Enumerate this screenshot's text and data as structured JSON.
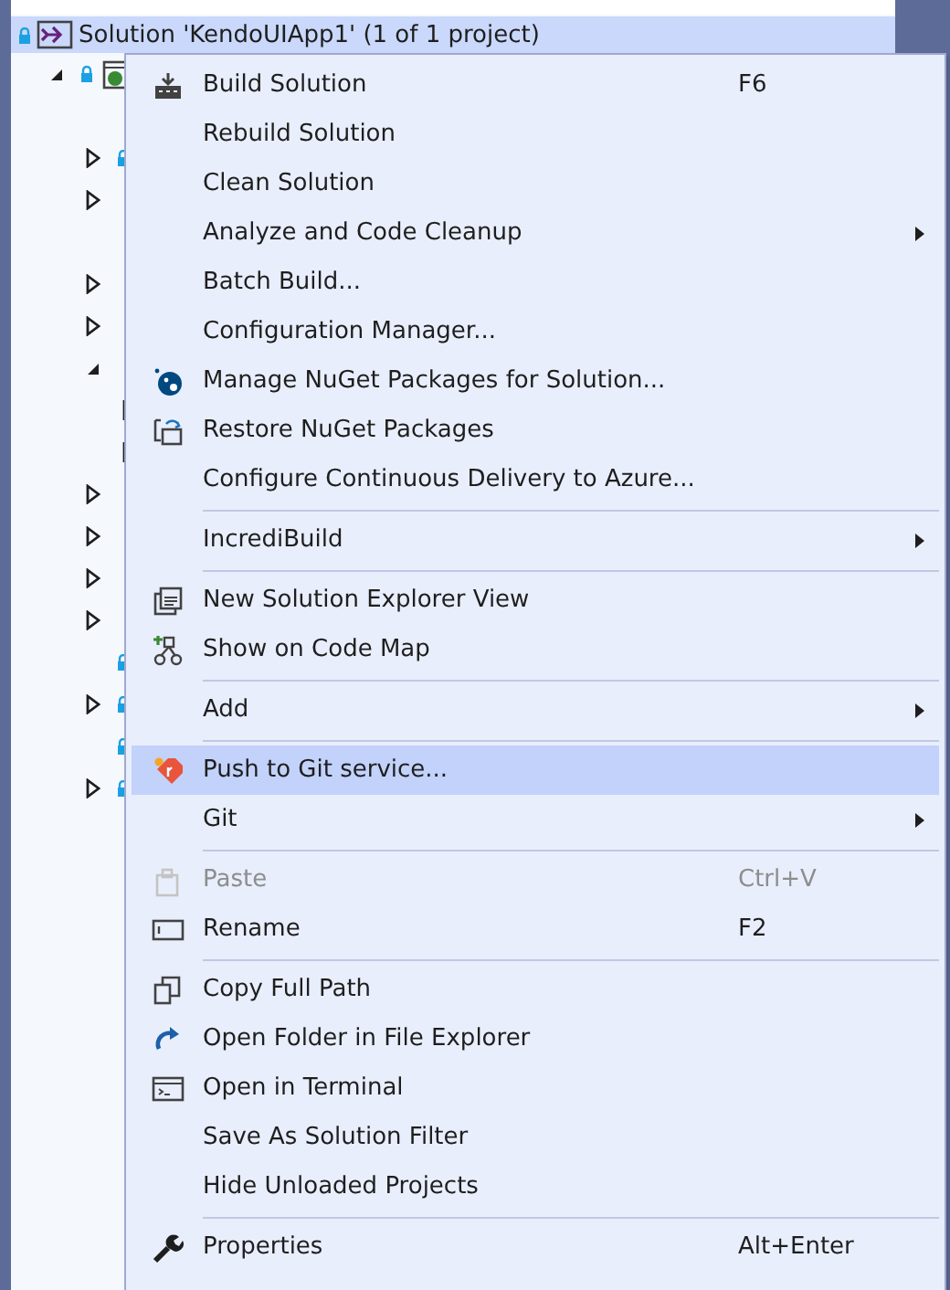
{
  "tree": {
    "root": {
      "label": "Solution 'KendoUIApp1' (1 of 1 project)",
      "selected": true
    },
    "rows": [
      {
        "expanded": true,
        "locked": true,
        "children": [
          {
            "locked": false
          },
          {
            "expanded": false,
            "locked": true
          },
          {
            "expanded": false,
            "locked": false
          },
          {
            "locked": false
          },
          {
            "expanded": false,
            "locked": false
          },
          {
            "expanded": false,
            "locked": false
          },
          {
            "expanded": true,
            "locked": false,
            "children": [
              {
                "expanded": false
              },
              {
                "expanded": false
              }
            ]
          },
          {
            "expanded": false,
            "locked": false
          },
          {
            "expanded": false,
            "locked": false
          },
          {
            "expanded": false,
            "locked": false
          },
          {
            "expanded": false,
            "locked": false
          },
          {
            "locked": true
          },
          {
            "expanded": false,
            "locked": true
          },
          {
            "locked": true
          },
          {
            "expanded": false,
            "locked": true
          }
        ]
      }
    ]
  },
  "menu": {
    "items": [
      {
        "kind": "item",
        "label": "Build Solution",
        "shortcut": "F6",
        "submenu": false,
        "selected": false,
        "disabled": false
      },
      {
        "kind": "item",
        "label": "Rebuild Solution",
        "submenu": false,
        "selected": false,
        "disabled": false
      },
      {
        "kind": "item",
        "label": "Clean Solution",
        "submenu": false,
        "selected": false,
        "disabled": false
      },
      {
        "kind": "item",
        "label": "Analyze and Code Cleanup",
        "submenu": true,
        "selected": false,
        "disabled": false
      },
      {
        "kind": "item",
        "label": "Batch Build...",
        "submenu": false,
        "selected": false,
        "disabled": false
      },
      {
        "kind": "item",
        "label": "Configuration Manager...",
        "submenu": false,
        "selected": false,
        "disabled": false
      },
      {
        "kind": "item",
        "label": "Manage NuGet Packages for Solution...",
        "submenu": false,
        "selected": false,
        "disabled": false
      },
      {
        "kind": "item",
        "label": "Restore NuGet Packages",
        "submenu": false,
        "selected": false,
        "disabled": false
      },
      {
        "kind": "item",
        "label": "Configure Continuous Delivery to Azure...",
        "submenu": false,
        "selected": false,
        "disabled": false
      },
      {
        "kind": "separator"
      },
      {
        "kind": "item",
        "label": "IncrediBuild",
        "submenu": true,
        "selected": false,
        "disabled": false
      },
      {
        "kind": "separator"
      },
      {
        "kind": "item",
        "label": "New Solution Explorer View",
        "submenu": false,
        "selected": false,
        "disabled": false
      },
      {
        "kind": "item",
        "label": "Show on Code Map",
        "submenu": false,
        "selected": false,
        "disabled": false
      },
      {
        "kind": "separator"
      },
      {
        "kind": "item",
        "label": "Add",
        "submenu": true,
        "selected": false,
        "disabled": false
      },
      {
        "kind": "separator"
      },
      {
        "kind": "item",
        "label": "Push to Git service...",
        "submenu": false,
        "selected": true,
        "disabled": false
      },
      {
        "kind": "item",
        "label": "Git",
        "submenu": true,
        "selected": false,
        "disabled": false
      },
      {
        "kind": "separator"
      },
      {
        "kind": "item",
        "label": "Paste",
        "shortcut": "Ctrl+V",
        "submenu": false,
        "selected": false,
        "disabled": true
      },
      {
        "kind": "item",
        "label": "Rename",
        "shortcut": "F2",
        "submenu": false,
        "selected": false,
        "disabled": false
      },
      {
        "kind": "separator"
      },
      {
        "kind": "item",
        "label": "Copy Full Path",
        "submenu": false,
        "selected": false,
        "disabled": false
      },
      {
        "kind": "item",
        "label": "Open Folder in File Explorer",
        "submenu": false,
        "selected": false,
        "disabled": false
      },
      {
        "kind": "item",
        "label": "Open in Terminal",
        "submenu": false,
        "selected": false,
        "disabled": false
      },
      {
        "kind": "item",
        "label": "Save As Solution Filter",
        "submenu": false,
        "selected": false,
        "disabled": false
      },
      {
        "kind": "item",
        "label": "Hide Unloaded Projects",
        "submenu": false,
        "selected": false,
        "disabled": false
      },
      {
        "kind": "separator"
      },
      {
        "kind": "item",
        "label": "Properties",
        "shortcut": "Alt+Enter",
        "submenu": false,
        "selected": false,
        "disabled": false
      }
    ]
  }
}
